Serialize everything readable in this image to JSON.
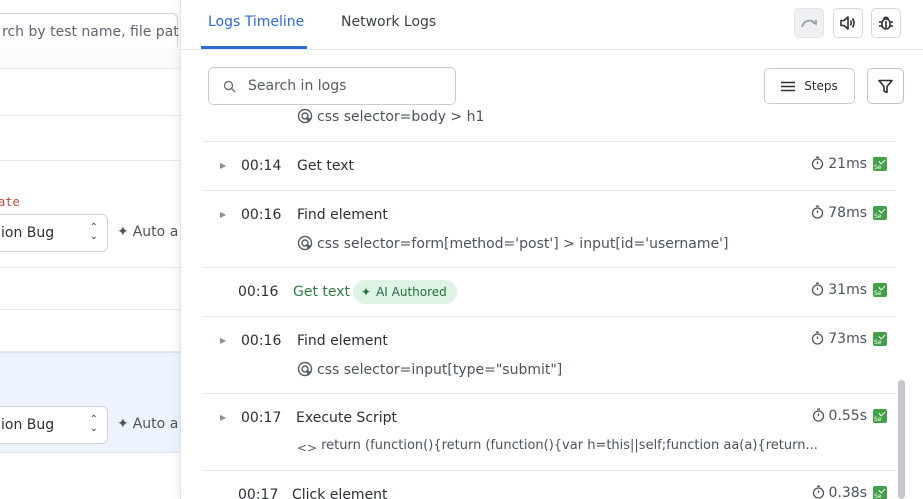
{
  "left_panel": {
    "search_placeholder": "rch by test name, file path,",
    "date_label": "ate",
    "bug_select_1": "ion Bug",
    "auto_label_1": "Auto a",
    "bug_select_2": "ion Bug",
    "auto_label_2": "Auto a"
  },
  "tabs": [
    {
      "label": "Logs Timeline",
      "active": true
    },
    {
      "label": "Network Logs",
      "active": false
    }
  ],
  "toolbar_icons": [
    "redo-icon",
    "speaker-icon",
    "bug-icon"
  ],
  "search": {
    "placeholder": "Search in logs"
  },
  "steps_button": {
    "label": "Steps"
  },
  "partial_row": {
    "detail": "css selector=body > h1"
  },
  "logs": [
    {
      "time": "00:14",
      "name": "Get text",
      "duration": "21ms",
      "detail": ""
    },
    {
      "time": "00:16",
      "name": "Find element",
      "duration": "78ms",
      "detail": "css selector=form[method='post'] > input[id='username']"
    },
    {
      "time": "00:16",
      "name": "Get text",
      "duration": "31ms",
      "detail": "",
      "badge": "AI Authored"
    },
    {
      "time": "00:16",
      "name": "Find element",
      "duration": "73ms",
      "detail": "css selector=input[type=\"submit\"]"
    },
    {
      "time": "00:17",
      "name": "Execute Script",
      "duration": "0.55s",
      "detail": "return (function(){return (function(){var h=this||self;function aa(a){return..."
    },
    {
      "time": "00:17",
      "name": "Click element",
      "duration": "0.38s",
      "detail": ""
    }
  ],
  "colors": {
    "accent": "#2f6ad3",
    "ai_badge_bg": "#def5e6",
    "ai_text": "#2f7a3e",
    "selenium_badge": "#43a047"
  }
}
